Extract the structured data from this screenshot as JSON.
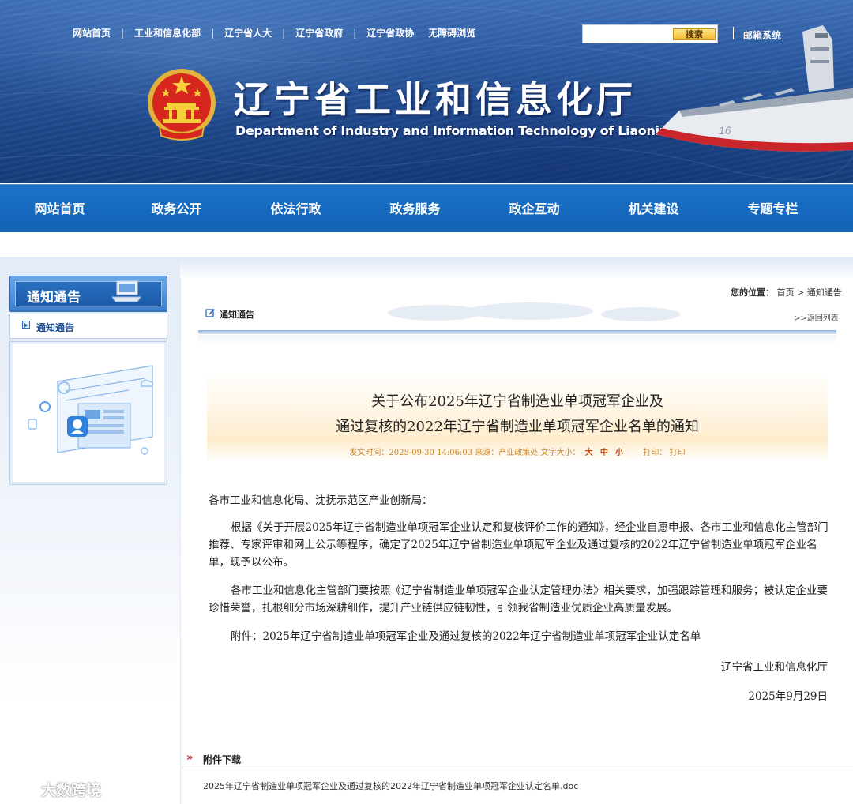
{
  "toplinks": {
    "home": "网站首页",
    "miit": "工业和信息化部",
    "npc": "辽宁省人大",
    "gov": "辽宁省政府",
    "cppcc": "辽宁省政协",
    "accessible": "无障碍浏览",
    "separator": "|"
  },
  "search": {
    "placeholder": "",
    "button": "搜索"
  },
  "mail": "邮箱系统",
  "site": {
    "title": "辽宁省工业和信息化厅",
    "subtitle": "Department of Industry and Information Technology of Liaoning Province"
  },
  "nav": {
    "items": [
      "网站首页",
      "政务公开",
      "依法行政",
      "政务服务",
      "政企互动",
      "机关建设",
      "专题专栏"
    ]
  },
  "sidebar": {
    "title": "通知通告",
    "menu_item": "通知通告"
  },
  "breadcrumb": {
    "prefix": "您的位置：",
    "home": "首页",
    "sep": ">",
    "current": "通知通告"
  },
  "column": {
    "label": "通知通告",
    "back": ">>返回列表"
  },
  "article": {
    "title_line1": "关于公布2025年辽宁省制造业单项冠军企业及",
    "title_line2": "通过复核的2022年辽宁省制造业单项冠军企业名单的通知",
    "meta_prefix": "发文时间：2025-09-30 14:06:03  来源：产业政策处  文字大小：",
    "size_large": "大",
    "size_medium": "中",
    "size_small": "小",
    "print_label": "打印：",
    "print_link": "打印",
    "salutation": "各市工业和信息化局、沈抚示范区产业创新局：",
    "para1": "根据《关于开展2025年辽宁省制造业单项冠军企业认定和复核评价工作的通知》，经企业自愿申报、各市工业和信息化主管部门推荐、专家评审和网上公示等程序，确定了2025年辽宁省制造业单项冠军企业及通过复核的2022年辽宁省制造业单项冠军企业名单，现予以公布。",
    "para2": "各市工业和信息化主管部门要按照《辽宁省制造业单项冠军企业认定管理办法》相关要求，加强跟踪管理和服务；被认定企业要珍惜荣誉，扎根细分市场深耕细作，提升产业链供应链韧性，引领我省制造业优质企业高质量发展。",
    "attachment_note": "附件：2025年辽宁省制造业单项冠军企业及通过复核的2022年辽宁省制造业单项冠军企业认定名单",
    "issuer": "辽宁省工业和信息化厅",
    "date": "2025年9月29日"
  },
  "attachments": {
    "heading": "附件下载",
    "icon": "»",
    "file": "2025年辽宁省制造业单项冠军企业及通过复核的2022年辽宁省制造业单项冠军企业认定名单.doc"
  },
  "watermark": "大数跨境",
  "colors": {
    "nav_blue": "#1b6ac0",
    "banner_blue": "#1f4d96",
    "meta_orange": "#c9852a"
  }
}
